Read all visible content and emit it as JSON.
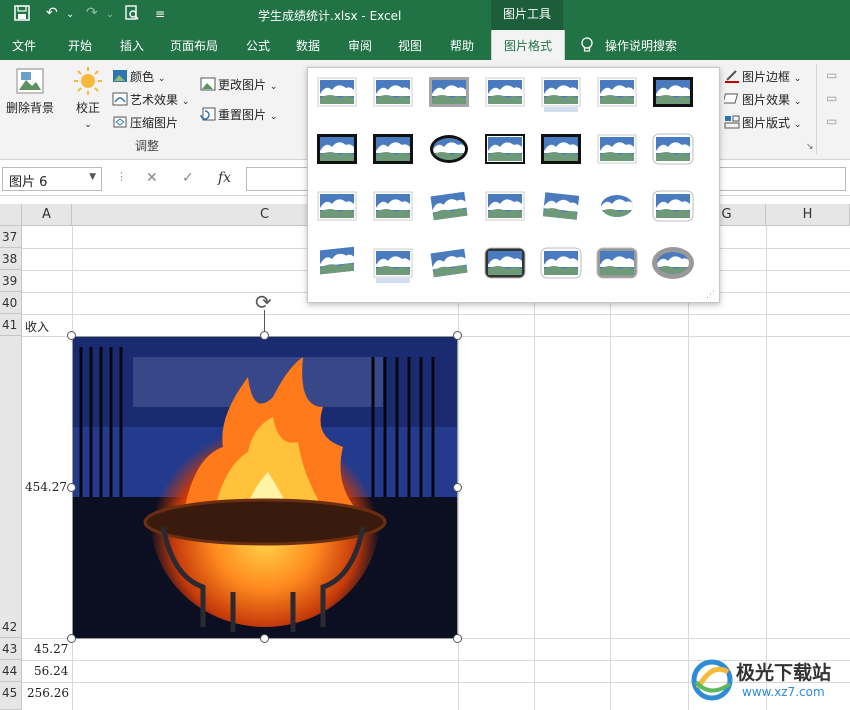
{
  "titlebar": {
    "title": "学生成绩统计.xlsx  -  Excel",
    "context_tool": "图片工具"
  },
  "menu": {
    "tabs": [
      "文件",
      "开始",
      "插入",
      "页面布局",
      "公式",
      "数据",
      "审阅",
      "视图",
      "帮助",
      "图片格式"
    ],
    "active": "图片格式",
    "search": "操作说明搜索"
  },
  "ribbon": {
    "remove_bg": "删除背景",
    "corrections": "校正",
    "color": "颜色",
    "artistic": "艺术效果",
    "compress": "压缩图片",
    "change_picture": "更改图片",
    "reset_picture": "重置图片",
    "adjust_group": "调整",
    "border": "图片边框",
    "effects": "图片效果",
    "layout": "图片版式"
  },
  "formula_bar": {
    "name_box": "图片 6",
    "cancel": "✕",
    "enter": "✓",
    "fx": "fx"
  },
  "columns": [
    "A",
    "C",
    "G",
    "H"
  ],
  "rows": [
    "37",
    "38",
    "39",
    "40",
    "41",
    "42",
    "43",
    "44",
    "45"
  ],
  "cells": {
    "a41": "收入",
    "b_mid": "454.27",
    "a43": "45.27",
    "a44": "56.24",
    "a45": "256.26"
  },
  "watermark": {
    "name": "极光下载站",
    "url": "www.xz7.com"
  },
  "colors": {
    "excel_green": "#217346",
    "gallery_sky": "#4a7bbf",
    "gallery_cloud": "#ffffff",
    "gallery_hill": "#6e9a7a"
  }
}
